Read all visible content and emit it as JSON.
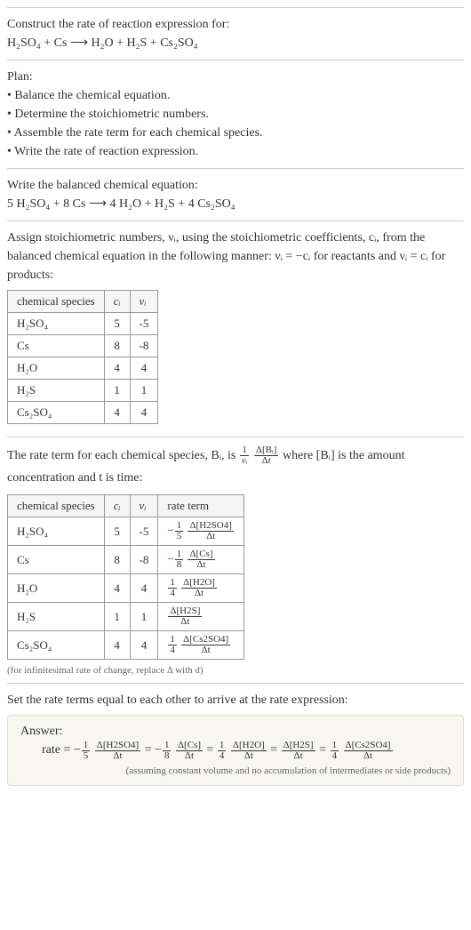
{
  "header": {
    "title": "Construct the rate of reaction expression for:",
    "equation": "H₂SO₄ + Cs ⟶ H₂O + H₂S + Cs₂SO₄"
  },
  "plan": {
    "title": "Plan:",
    "items": [
      "Balance the chemical equation.",
      "Determine the stoichiometric numbers.",
      "Assemble the rate term for each chemical species.",
      "Write the rate of reaction expression."
    ]
  },
  "balanced": {
    "title": "Write the balanced chemical equation:",
    "equation": "5 H₂SO₄ + 8 Cs ⟶ 4 H₂O + H₂S + 4 Cs₂SO₄"
  },
  "assign": {
    "text1": "Assign stoichiometric numbers, νᵢ, using the stoichiometric coefficients, cᵢ, from the balanced chemical equation in the following manner: νᵢ = −cᵢ for reactants and νᵢ = cᵢ for products:",
    "headers": [
      "chemical species",
      "cᵢ",
      "νᵢ"
    ],
    "rows": [
      {
        "sp": "H₂SO₄",
        "c": "5",
        "v": "-5"
      },
      {
        "sp": "Cs",
        "c": "8",
        "v": "-8"
      },
      {
        "sp": "H₂O",
        "c": "4",
        "v": "4"
      },
      {
        "sp": "H₂S",
        "c": "1",
        "v": "1"
      },
      {
        "sp": "Cs₂SO₄",
        "c": "4",
        "v": "4"
      }
    ]
  },
  "rateterm": {
    "intro_a": "The rate term for each chemical species, Bᵢ, is ",
    "intro_b": " where [Bᵢ] is the amount concentration and t is time:",
    "headers": [
      "chemical species",
      "cᵢ",
      "νᵢ",
      "rate term"
    ],
    "rows": [
      {
        "sp": "H₂SO₄",
        "c": "5",
        "v": "-5",
        "rt_pre": "−",
        "rt_coef_num": "1",
        "rt_coef_den": "5",
        "rt_d_num": "Δ[H2SO4]",
        "rt_d_den": "Δt"
      },
      {
        "sp": "Cs",
        "c": "8",
        "v": "-8",
        "rt_pre": "−",
        "rt_coef_num": "1",
        "rt_coef_den": "8",
        "rt_d_num": "Δ[Cs]",
        "rt_d_den": "Δt"
      },
      {
        "sp": "H₂O",
        "c": "4",
        "v": "4",
        "rt_pre": "",
        "rt_coef_num": "1",
        "rt_coef_den": "4",
        "rt_d_num": "Δ[H2O]",
        "rt_d_den": "Δt"
      },
      {
        "sp": "H₂S",
        "c": "1",
        "v": "1",
        "rt_pre": "",
        "rt_coef_num": "",
        "rt_coef_den": "",
        "rt_d_num": "Δ[H2S]",
        "rt_d_den": "Δt"
      },
      {
        "sp": "Cs₂SO₄",
        "c": "4",
        "v": "4",
        "rt_pre": "",
        "rt_coef_num": "1",
        "rt_coef_den": "4",
        "rt_d_num": "Δ[Cs2SO4]",
        "rt_d_den": "Δt"
      }
    ],
    "footnote": "(for infinitesimal rate of change, replace Δ with d)"
  },
  "setequal": {
    "title": "Set the rate terms equal to each other to arrive at the rate expression:"
  },
  "answer": {
    "label": "Answer:",
    "expr_lead": "rate = ",
    "terms": [
      {
        "pre": "−",
        "cn": "1",
        "cd": "5",
        "dn": "Δ[H2SO4]",
        "dd": "Δt"
      },
      {
        "pre": "= −",
        "cn": "1",
        "cd": "8",
        "dn": "Δ[Cs]",
        "dd": "Δt"
      },
      {
        "pre": "= ",
        "cn": "1",
        "cd": "4",
        "dn": "Δ[H2O]",
        "dd": "Δt"
      },
      {
        "pre": "= ",
        "cn": "",
        "cd": "",
        "dn": "Δ[H2S]",
        "dd": "Δt"
      },
      {
        "pre": "= ",
        "cn": "1",
        "cd": "4",
        "dn": "Δ[Cs2SO4]",
        "dd": "Δt"
      }
    ],
    "note": "(assuming constant volume and no accumulation of intermediates or side products)"
  },
  "chart_data": {
    "type": "table",
    "tables": [
      {
        "title": "Stoichiometric numbers",
        "headers": [
          "chemical species",
          "cᵢ",
          "νᵢ"
        ],
        "rows": [
          [
            "H2SO4",
            5,
            -5
          ],
          [
            "Cs",
            8,
            -8
          ],
          [
            "H2O",
            4,
            4
          ],
          [
            "H2S",
            1,
            1
          ],
          [
            "Cs2SO4",
            4,
            4
          ]
        ]
      },
      {
        "title": "Rate terms",
        "headers": [
          "chemical species",
          "cᵢ",
          "νᵢ",
          "rate term"
        ],
        "rows": [
          [
            "H2SO4",
            5,
            -5,
            "-(1/5) Δ[H2SO4]/Δt"
          ],
          [
            "Cs",
            8,
            -8,
            "-(1/8) Δ[Cs]/Δt"
          ],
          [
            "H2O",
            4,
            4,
            "(1/4) Δ[H2O]/Δt"
          ],
          [
            "H2S",
            1,
            1,
            "Δ[H2S]/Δt"
          ],
          [
            "Cs2SO4",
            4,
            4,
            "(1/4) Δ[Cs2SO4]/Δt"
          ]
        ]
      }
    ]
  }
}
